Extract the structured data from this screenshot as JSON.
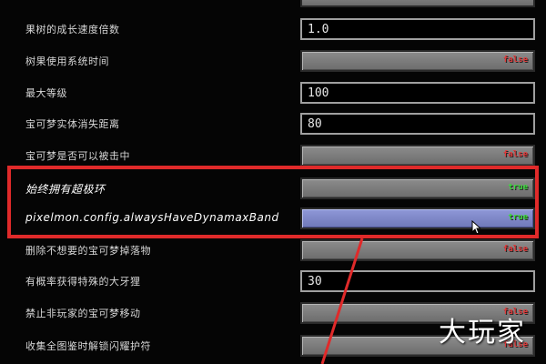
{
  "settings": [
    {
      "label": "果树的成长速度倍数",
      "type": "text",
      "value": "1.0"
    },
    {
      "label": "树果使用系统时间",
      "type": "toggle",
      "value": "false"
    },
    {
      "label": "最大等级",
      "type": "text",
      "value": "100"
    },
    {
      "label": "宝可梦实体消失距离",
      "type": "text",
      "value": "80"
    },
    {
      "label": "宝可梦是否可以被击中",
      "type": "toggle",
      "value": "false"
    },
    {
      "label": "始终拥有超极环",
      "type": "toggle",
      "value": "true"
    },
    {
      "label": "pixelmon.config.alwaysHaveDynamaxBand",
      "type": "toggle",
      "value": "true"
    },
    {
      "label": "删除不想要的宝可梦掉落物",
      "type": "toggle",
      "value": "false"
    },
    {
      "label": "有概率获得特殊的大牙狸",
      "type": "text",
      "value": "30"
    },
    {
      "label": "禁止非玩家的宝可梦移动",
      "type": "toggle",
      "value": "false"
    },
    {
      "label": "收集全图鉴时解锁闪耀护符",
      "type": "toggle",
      "value": "false"
    }
  ],
  "watermark": "大玩家",
  "colors": {
    "highlight": "#e02a2a",
    "true": "#3ee03e",
    "false": "#e03a3a",
    "hover_button": "#7f88c8"
  }
}
